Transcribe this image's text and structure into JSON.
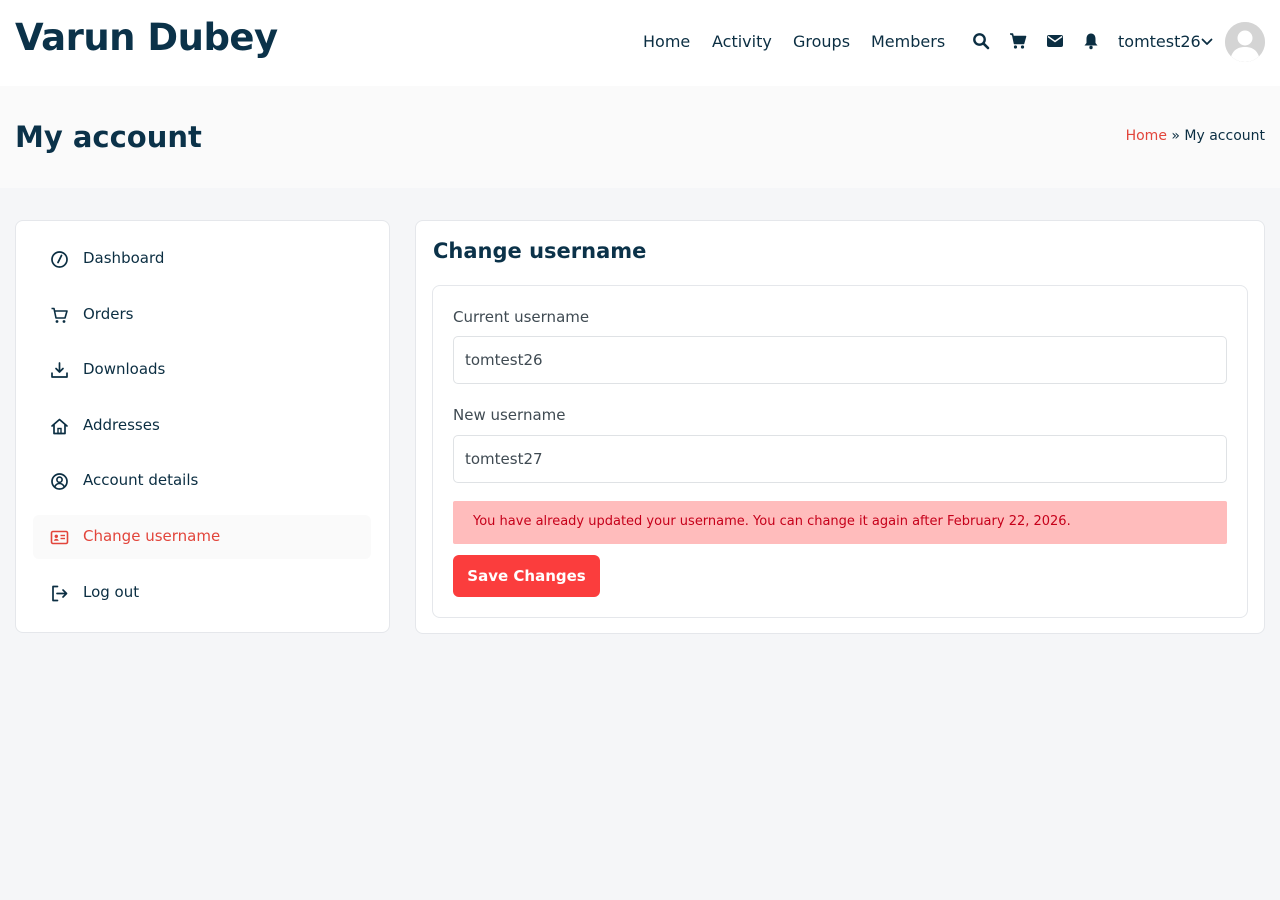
{
  "site": {
    "title": "Varun Dubey"
  },
  "nav": {
    "items": [
      {
        "label": "Home"
      },
      {
        "label": "Activity"
      },
      {
        "label": "Groups"
      },
      {
        "label": "Members"
      }
    ]
  },
  "header_icons": [
    "search-icon",
    "cart-icon",
    "envelope-icon",
    "bell-icon"
  ],
  "user": {
    "name": "tomtest26"
  },
  "page": {
    "title": "My account",
    "breadcrumb": {
      "home": "Home",
      "separator": " » ",
      "current": "My account"
    }
  },
  "sidebar": {
    "items": [
      {
        "label": "Dashboard",
        "icon": "dashboard-icon"
      },
      {
        "label": "Orders",
        "icon": "cart-icon"
      },
      {
        "label": "Downloads",
        "icon": "download-icon"
      },
      {
        "label": "Addresses",
        "icon": "home-icon"
      },
      {
        "label": "Account details",
        "icon": "user-circle-icon"
      },
      {
        "label": "Change username",
        "icon": "id-card-icon",
        "active": true
      },
      {
        "label": "Log out",
        "icon": "logout-icon"
      }
    ]
  },
  "form": {
    "heading": "Change username",
    "current_label": "Current username",
    "current_value": "tomtest26",
    "new_label": "New username",
    "new_value": "tomtest27",
    "error": "You have already updated your username. You can change it again after February 22, 2026.",
    "save_label": "Save Changes"
  },
  "colors": {
    "accent": "#e2453b",
    "button": "#fb3d3d",
    "error_bg": "#ffbcbc",
    "error_text": "#c6001a",
    "text": "#0b2e42"
  }
}
